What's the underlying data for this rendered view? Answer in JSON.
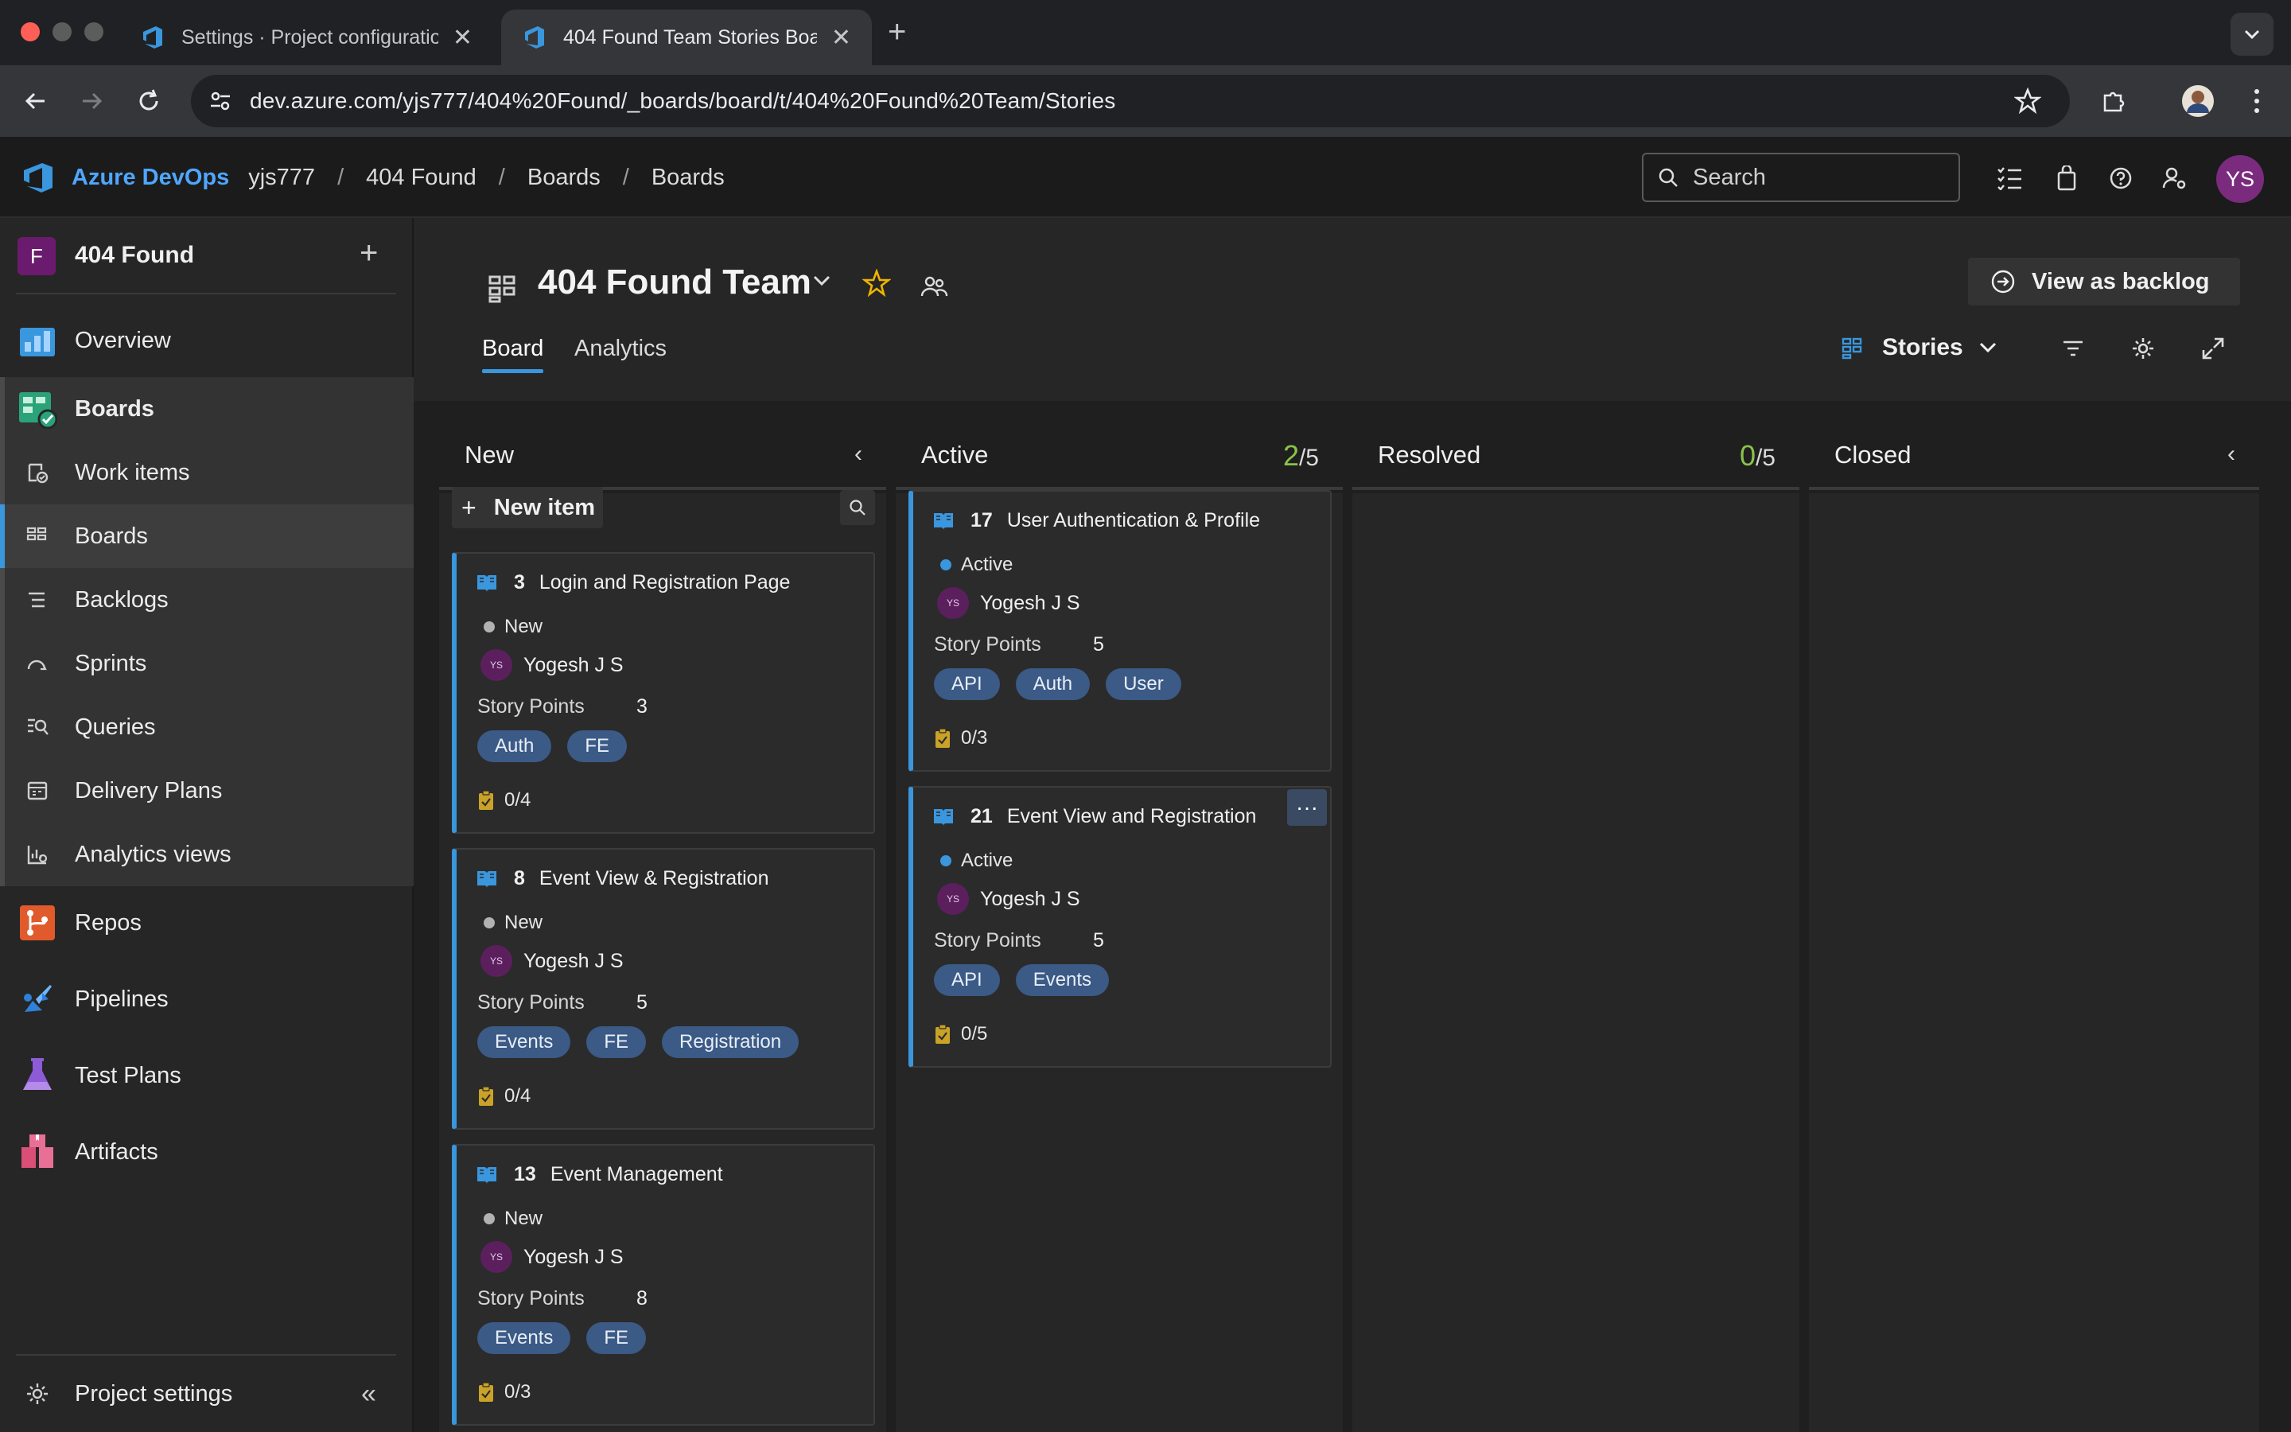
{
  "browser": {
    "tabs": [
      {
        "title": "Settings · Project configuratio"
      },
      {
        "title": "404 Found Team Stories Boar"
      }
    ],
    "url": "dev.azure.com/yjs777/404%20Found/_boards/board/t/404%20Found%20Team/Stories"
  },
  "header": {
    "brand": "Azure DevOps",
    "breadcrumbs": [
      "yjs777",
      "404 Found",
      "Boards",
      "Boards"
    ],
    "search_placeholder": "Search",
    "avatar_initials": "YS"
  },
  "sidebar": {
    "project_initial": "F",
    "project_name": "404 Found",
    "items": [
      {
        "label": "Overview"
      },
      {
        "label": "Boards"
      },
      {
        "label": "Work items"
      },
      {
        "label": "Boards"
      },
      {
        "label": "Backlogs"
      },
      {
        "label": "Sprints"
      },
      {
        "label": "Queries"
      },
      {
        "label": "Delivery Plans"
      },
      {
        "label": "Analytics views"
      },
      {
        "label": "Repos"
      },
      {
        "label": "Pipelines"
      },
      {
        "label": "Test Plans"
      },
      {
        "label": "Artifacts"
      }
    ],
    "footer_label": "Project settings"
  },
  "page": {
    "team_title": "404 Found Team",
    "tabs": [
      "Board",
      "Analytics"
    ],
    "view_backlog_label": "View as backlog",
    "backlog_level": "Stories"
  },
  "columns": [
    {
      "name": "New"
    },
    {
      "name": "Active",
      "wip_count": "2",
      "wip_limit": "/5"
    },
    {
      "name": "Resolved",
      "wip_count": "0",
      "wip_limit": "/5"
    },
    {
      "name": "Closed"
    }
  ],
  "new_item_label": "New item",
  "story_points_label": "Story Points",
  "cards": [
    {
      "id": "3",
      "title": "Login and Registration Page",
      "state": "New",
      "assignee": "Yogesh J S",
      "avatar": "YS",
      "points": "3",
      "tags": [
        "Auth",
        "FE"
      ],
      "tasks": "0/4"
    },
    {
      "id": "8",
      "title": "Event View & Registration",
      "state": "New",
      "assignee": "Yogesh J S",
      "avatar": "YS",
      "points": "5",
      "tags": [
        "Events",
        "FE",
        "Registration"
      ],
      "tasks": "0/4"
    },
    {
      "id": "13",
      "title": "Event Management",
      "state": "New",
      "assignee": "Yogesh J S",
      "avatar": "YS",
      "points": "8",
      "tags": [
        "Events",
        "FE"
      ],
      "tasks": "0/3"
    },
    {
      "id": "17",
      "title": "User Authentication & Profile",
      "state": "Active",
      "assignee": "Yogesh J S",
      "avatar": "YS",
      "points": "5",
      "tags": [
        "API",
        "Auth",
        "User"
      ],
      "tasks": "0/3"
    },
    {
      "id": "21",
      "title": "Event View and Registration",
      "state": "Active",
      "assignee": "Yogesh J S",
      "avatar": "YS",
      "points": "5",
      "tags": [
        "API",
        "Events"
      ],
      "tasks": "0/5"
    }
  ],
  "colors": {
    "accent": "#3a96dd",
    "state_new": "#b2b2b2",
    "state_active": "#3a96dd",
    "tag_bg": "#3b5a86",
    "wip_ok": "#8bc34a"
  }
}
